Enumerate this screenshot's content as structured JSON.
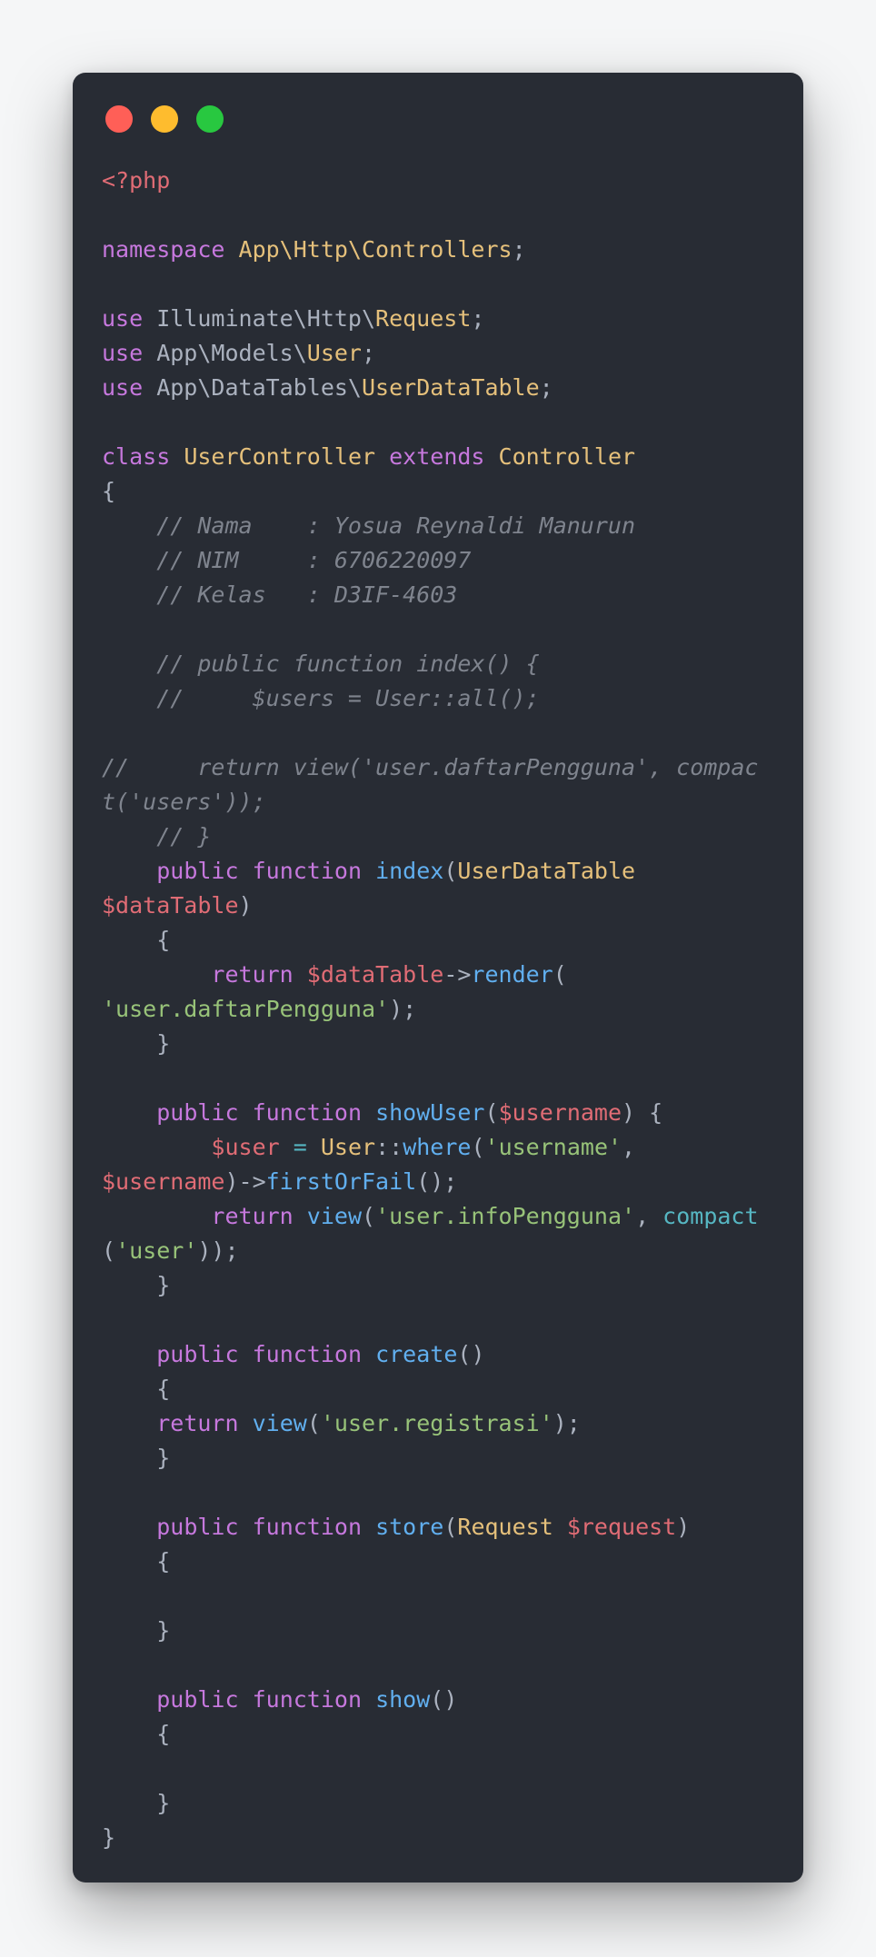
{
  "window": {
    "buttons": [
      {
        "name": "close",
        "color": "#ff5f57"
      },
      {
        "name": "minimize",
        "color": "#febc2e"
      },
      {
        "name": "maximize",
        "color": "#28c840"
      }
    ]
  },
  "code": {
    "language": "php",
    "lines": [
      [
        [
          "tag",
          "<?php"
        ]
      ],
      [],
      [
        [
          "keyword",
          "namespace"
        ],
        [
          "plain",
          " "
        ],
        [
          "class",
          "App\\Http\\Controllers"
        ],
        [
          "plain",
          ";"
        ]
      ],
      [],
      [
        [
          "keyword",
          "use"
        ],
        [
          "plain",
          " Illuminate\\Http\\"
        ],
        [
          "class",
          "Request"
        ],
        [
          "plain",
          ";"
        ]
      ],
      [
        [
          "keyword",
          "use"
        ],
        [
          "plain",
          " App\\Models\\"
        ],
        [
          "class",
          "User"
        ],
        [
          "plain",
          ";"
        ]
      ],
      [
        [
          "keyword",
          "use"
        ],
        [
          "plain",
          " App\\DataTables\\"
        ],
        [
          "class",
          "UserDataTable"
        ],
        [
          "plain",
          ";"
        ]
      ],
      [],
      [
        [
          "keyword",
          "class"
        ],
        [
          "plain",
          " "
        ],
        [
          "class",
          "UserController"
        ],
        [
          "plain",
          " "
        ],
        [
          "keyword",
          "extends"
        ],
        [
          "plain",
          " "
        ],
        [
          "class",
          "Controller"
        ]
      ],
      [
        [
          "plain",
          "{"
        ]
      ],
      [
        [
          "plain",
          "    "
        ],
        [
          "comment",
          "// Nama    : Yosua Reynaldi Manurun"
        ]
      ],
      [
        [
          "plain",
          "    "
        ],
        [
          "comment",
          "// NIM     : 6706220097"
        ]
      ],
      [
        [
          "plain",
          "    "
        ],
        [
          "comment",
          "// Kelas   : D3IF-4603"
        ]
      ],
      [],
      [
        [
          "plain",
          "    "
        ],
        [
          "comment",
          "// public function index() {"
        ]
      ],
      [
        [
          "plain",
          "    "
        ],
        [
          "comment",
          "//     $users = User::all();"
        ]
      ],
      [],
      [
        [
          "comment",
          "//     return view('user.daftarPengguna', compac"
        ]
      ],
      [
        [
          "comment",
          "t('users'));"
        ]
      ],
      [
        [
          "plain",
          "    "
        ],
        [
          "comment",
          "// }"
        ]
      ],
      [
        [
          "plain",
          "    "
        ],
        [
          "keyword",
          "public"
        ],
        [
          "plain",
          " "
        ],
        [
          "keyword",
          "function"
        ],
        [
          "plain",
          " "
        ],
        [
          "func",
          "index"
        ],
        [
          "plain",
          "("
        ],
        [
          "class",
          "UserDataTable"
        ]
      ],
      [
        [
          "var",
          "$dataTable"
        ],
        [
          "plain",
          ")"
        ]
      ],
      [
        [
          "plain",
          "    {"
        ]
      ],
      [
        [
          "plain",
          "        "
        ],
        [
          "keyword",
          "return"
        ],
        [
          "plain",
          " "
        ],
        [
          "var",
          "$dataTable"
        ],
        [
          "plain",
          "->"
        ],
        [
          "func",
          "render"
        ],
        [
          "plain",
          "("
        ]
      ],
      [
        [
          "string",
          "'user.daftarPengguna'"
        ],
        [
          "plain",
          ");"
        ]
      ],
      [
        [
          "plain",
          "    }"
        ]
      ],
      [],
      [
        [
          "plain",
          "    "
        ],
        [
          "keyword",
          "public"
        ],
        [
          "plain",
          " "
        ],
        [
          "keyword",
          "function"
        ],
        [
          "plain",
          " "
        ],
        [
          "func",
          "showUser"
        ],
        [
          "plain",
          "("
        ],
        [
          "var",
          "$username"
        ],
        [
          "plain",
          ") {"
        ]
      ],
      [
        [
          "plain",
          "        "
        ],
        [
          "var",
          "$user"
        ],
        [
          "plain",
          " "
        ],
        [
          "op",
          "="
        ],
        [
          "plain",
          " "
        ],
        [
          "class",
          "User"
        ],
        [
          "plain",
          "::"
        ],
        [
          "func",
          "where"
        ],
        [
          "plain",
          "("
        ],
        [
          "string",
          "'username'"
        ],
        [
          "plain",
          ","
        ]
      ],
      [
        [
          "var",
          "$username"
        ],
        [
          "plain",
          ")->"
        ],
        [
          "func",
          "firstOrFail"
        ],
        [
          "plain",
          "();"
        ]
      ],
      [
        [
          "plain",
          "        "
        ],
        [
          "keyword",
          "return"
        ],
        [
          "plain",
          " "
        ],
        [
          "func",
          "view"
        ],
        [
          "plain",
          "("
        ],
        [
          "string",
          "'user.infoPengguna'"
        ],
        [
          "plain",
          ", "
        ],
        [
          "builtin",
          "compact"
        ]
      ],
      [
        [
          "plain",
          "("
        ],
        [
          "string",
          "'user'"
        ],
        [
          "plain",
          "));"
        ]
      ],
      [
        [
          "plain",
          "    }"
        ]
      ],
      [],
      [
        [
          "plain",
          "    "
        ],
        [
          "keyword",
          "public"
        ],
        [
          "plain",
          " "
        ],
        [
          "keyword",
          "function"
        ],
        [
          "plain",
          " "
        ],
        [
          "func",
          "create"
        ],
        [
          "plain",
          "()"
        ]
      ],
      [
        [
          "plain",
          "    {"
        ]
      ],
      [
        [
          "plain",
          "    "
        ],
        [
          "keyword",
          "return"
        ],
        [
          "plain",
          " "
        ],
        [
          "func",
          "view"
        ],
        [
          "plain",
          "("
        ],
        [
          "string",
          "'user.registrasi'"
        ],
        [
          "plain",
          ");"
        ]
      ],
      [
        [
          "plain",
          "    }"
        ]
      ],
      [],
      [
        [
          "plain",
          "    "
        ],
        [
          "keyword",
          "public"
        ],
        [
          "plain",
          " "
        ],
        [
          "keyword",
          "function"
        ],
        [
          "plain",
          " "
        ],
        [
          "func",
          "store"
        ],
        [
          "plain",
          "("
        ],
        [
          "class",
          "Request"
        ],
        [
          "plain",
          " "
        ],
        [
          "var",
          "$request"
        ],
        [
          "plain",
          ")"
        ]
      ],
      [
        [
          "plain",
          "    {"
        ]
      ],
      [],
      [
        [
          "plain",
          "    }"
        ]
      ],
      [],
      [
        [
          "plain",
          "    "
        ],
        [
          "keyword",
          "public"
        ],
        [
          "plain",
          " "
        ],
        [
          "keyword",
          "function"
        ],
        [
          "plain",
          " "
        ],
        [
          "func",
          "show"
        ],
        [
          "plain",
          "()"
        ]
      ],
      [
        [
          "plain",
          "    {"
        ]
      ],
      [],
      [
        [
          "plain",
          "    }"
        ]
      ],
      [
        [
          "plain",
          "}"
        ]
      ]
    ]
  }
}
